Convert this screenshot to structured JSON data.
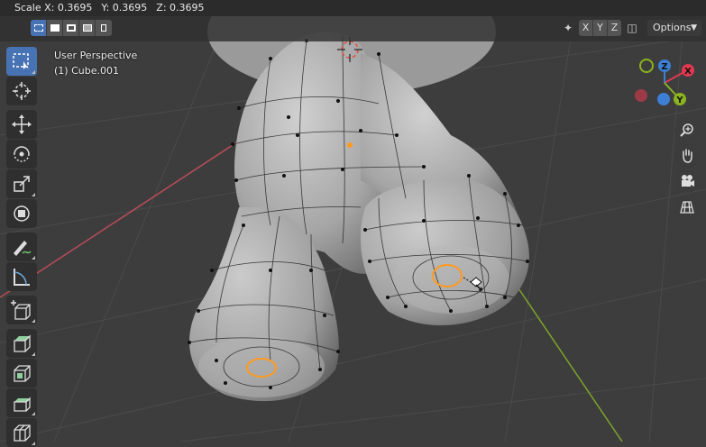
{
  "status_bar": {
    "scale_x": "Scale X: 0.3695",
    "scale_y": "Y: 0.3695",
    "scale_z": "Z: 0.3695"
  },
  "header": {
    "select_modes": [
      "select-new-icon",
      "select-extend-icon",
      "select-subtract-icon",
      "select-invert-icon",
      "select-intersect-icon"
    ],
    "mirror_axes": [
      "X",
      "Y",
      "Z"
    ],
    "options_label": "Options"
  },
  "viewport_info": {
    "perspective": "User Perspective",
    "object": "(1) Cube.001"
  },
  "toolbar": {
    "tools": [
      "select-box",
      "cursor",
      "move",
      "rotate",
      "scale",
      "transform",
      "annotate",
      "measure",
      "add-cube",
      "extrude-region",
      "inset-faces",
      "bevel",
      "loop-cut"
    ],
    "active_tool": "select-box"
  },
  "gizmo": {
    "axis_labels": {
      "x": "X",
      "y": "Y",
      "z": "Z"
    },
    "colors": {
      "x": "#e0394f",
      "y": "#8cb31f",
      "z": "#3d7fd4",
      "x_neg": "#9c3a48",
      "y_neg": "#6a8a22"
    },
    "nav_buttons": [
      "zoom-icon",
      "pan-hand-icon",
      "camera-icon",
      "grid-ortho-icon"
    ]
  },
  "colors": {
    "background": "#3d3d3d",
    "grid": "#4a4a4a",
    "x_axis_line": "#b84c58",
    "y_axis_line": "#7ea628",
    "mesh": "#a6a6a6",
    "selected_vertex": "#ff9a1f",
    "active_tool": "#4772b3"
  }
}
